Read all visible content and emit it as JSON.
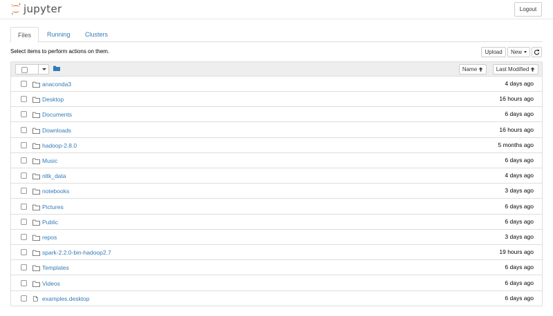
{
  "header": {
    "logo_text": "jupyter",
    "logout_label": "Logout"
  },
  "tabs": [
    {
      "label": "Files",
      "active": true
    },
    {
      "label": "Running",
      "active": false
    },
    {
      "label": "Clusters",
      "active": false
    }
  ],
  "instructions": "Select items to perform actions on them.",
  "toolbar": {
    "upload_label": "Upload",
    "new_label": "New",
    "refresh_icon": "refresh-icon"
  },
  "list_header": {
    "name_sort_label": "Name",
    "modified_sort_label": "Last Modified"
  },
  "colors": {
    "link": "#337ab7",
    "orange": "#f37626",
    "header_bg": "#eeeeee",
    "border": "#dddddd"
  },
  "items": [
    {
      "name": "anaconda3",
      "type": "folder",
      "modified": "4 days ago"
    },
    {
      "name": "Desktop",
      "type": "folder",
      "modified": "16 hours ago"
    },
    {
      "name": "Documents",
      "type": "folder",
      "modified": "6 days ago"
    },
    {
      "name": "Downloads",
      "type": "folder",
      "modified": "16 hours ago"
    },
    {
      "name": "hadoop-2.8.0",
      "type": "folder",
      "modified": "5 months ago"
    },
    {
      "name": "Music",
      "type": "folder",
      "modified": "6 days ago"
    },
    {
      "name": "nltk_data",
      "type": "folder",
      "modified": "4 days ago"
    },
    {
      "name": "notebooks",
      "type": "folder",
      "modified": "3 days ago"
    },
    {
      "name": "Pictures",
      "type": "folder",
      "modified": "6 days ago"
    },
    {
      "name": "Public",
      "type": "folder",
      "modified": "6 days ago"
    },
    {
      "name": "repos",
      "type": "folder",
      "modified": "3 days ago"
    },
    {
      "name": "spark-2.2.0-bin-hadoop2.7",
      "type": "folder",
      "modified": "19 hours ago"
    },
    {
      "name": "Templates",
      "type": "folder",
      "modified": "6 days ago"
    },
    {
      "name": "Videos",
      "type": "folder",
      "modified": "6 days ago"
    },
    {
      "name": "examples.desktop",
      "type": "file",
      "modified": "6 days ago"
    }
  ]
}
